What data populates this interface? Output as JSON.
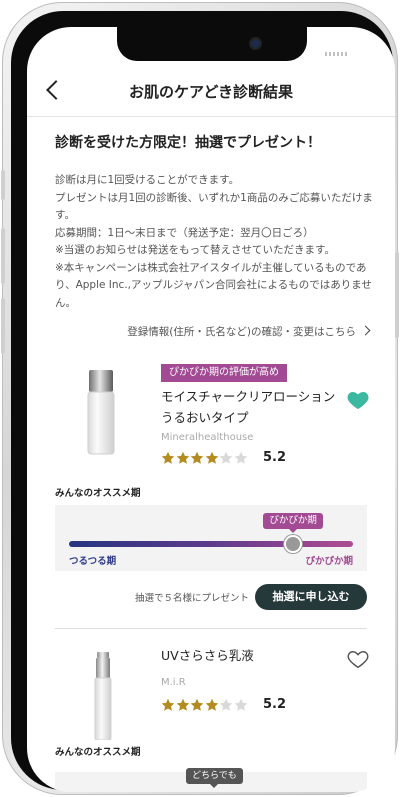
{
  "header": {
    "title": "お肌のケアどき診断結果"
  },
  "lottery": {
    "title": "診断を受けた方限定！抽選でプレゼント！",
    "lines": [
      "診断は月に1回受けることができます。",
      "プレゼントは月1回の診断後、いずれか1商品のみご応募いただけます。",
      "応募期間：1日〜末日まで（発送予定：翌月〇日ごろ）",
      "※当選のお知らせは発送をもって替えさせていただきます。",
      "※本キャンペーンは株式会社アイスタイルが主催しているものであり、Apple Inc.,アップルジャパン合同会社によるものではありません。"
    ],
    "registration_link": "登録情報(住所・氏名など)の確認・変更はこちら"
  },
  "products": [
    {
      "badge": "ぴかぴか期の評価が高め",
      "name": "モイスチャークリアローションうるおいタイプ",
      "brand": "Mineralhealthouse",
      "stars": 4,
      "rating": "5.2",
      "favorited": true,
      "recommend_label": "みんなのオススメ期",
      "slider": {
        "bubble": "ぴかぴか期",
        "left_label": "つるつる期",
        "right_label": "ぴかぴか期",
        "position": 0.79
      },
      "present_note": "抽選で５名様にプレゼント",
      "apply_label": "抽選に申し込む"
    },
    {
      "name": "UVさらさら乳液",
      "brand": "M.i.R",
      "stars": 4,
      "rating": "5.2",
      "favorited": false,
      "recommend_label": "みんなのオススメ期",
      "slider": {
        "bubble": "どちらでも"
      }
    }
  ],
  "colors": {
    "accent": "#a24a93",
    "heart_filled": "#3cb8a0",
    "star": "#b38b1f",
    "button": "#26393a"
  }
}
